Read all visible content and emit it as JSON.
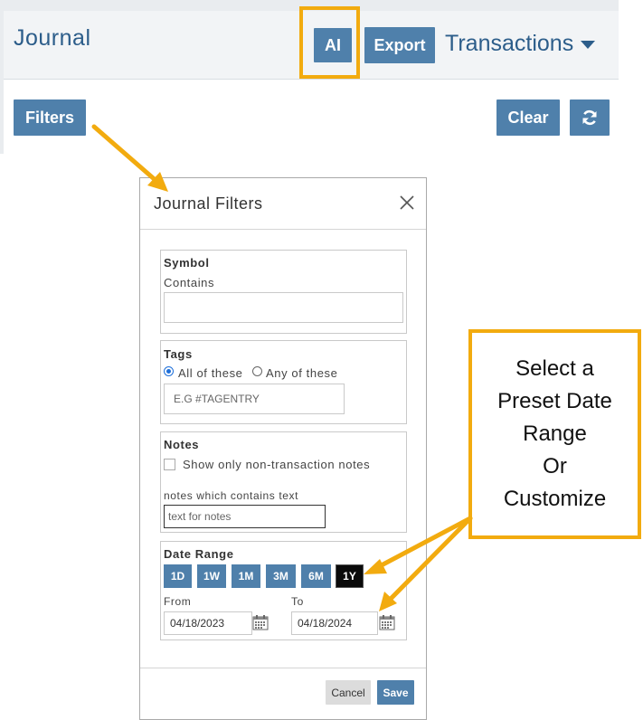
{
  "header": {
    "title": "Journal",
    "ai_label": "AI",
    "export_label": "Export",
    "transactions_label": "Transactions"
  },
  "toolbar": {
    "filters_label": "Filters",
    "clear_label": "Clear",
    "refresh_icon": "refresh-icon"
  },
  "modal": {
    "title": "Journal Filters",
    "symbol": {
      "legend": "Symbol",
      "contains_label": "Contains",
      "value": ""
    },
    "tags": {
      "legend": "Tags",
      "all_label": "All of these",
      "any_label": "Any of these",
      "selected": "all",
      "placeholder": "E.G #TAGENTRY"
    },
    "notes": {
      "legend": "Notes",
      "checkbox_label": "Show only non-transaction notes",
      "checkbox_checked": false,
      "text_label": "notes which contains text",
      "placeholder": "text for notes"
    },
    "date_range": {
      "legend": "Date Range",
      "presets": [
        "1D",
        "1W",
        "1M",
        "3M",
        "6M",
        "1Y"
      ],
      "active_preset": "1Y",
      "from_label": "From",
      "to_label": "To",
      "from_value": "04/18/2023",
      "to_value": "04/18/2024"
    },
    "cancel_label": "Cancel",
    "save_label": "Save"
  },
  "callout": {
    "lines": [
      "Select a",
      "Preset Date",
      "Range",
      "Or",
      "Customize"
    ]
  },
  "colors": {
    "button": "#4f80ab",
    "highlight": "#f2ab0f",
    "title": "#2c5d8a",
    "active_preset": "#0a0a0a"
  }
}
